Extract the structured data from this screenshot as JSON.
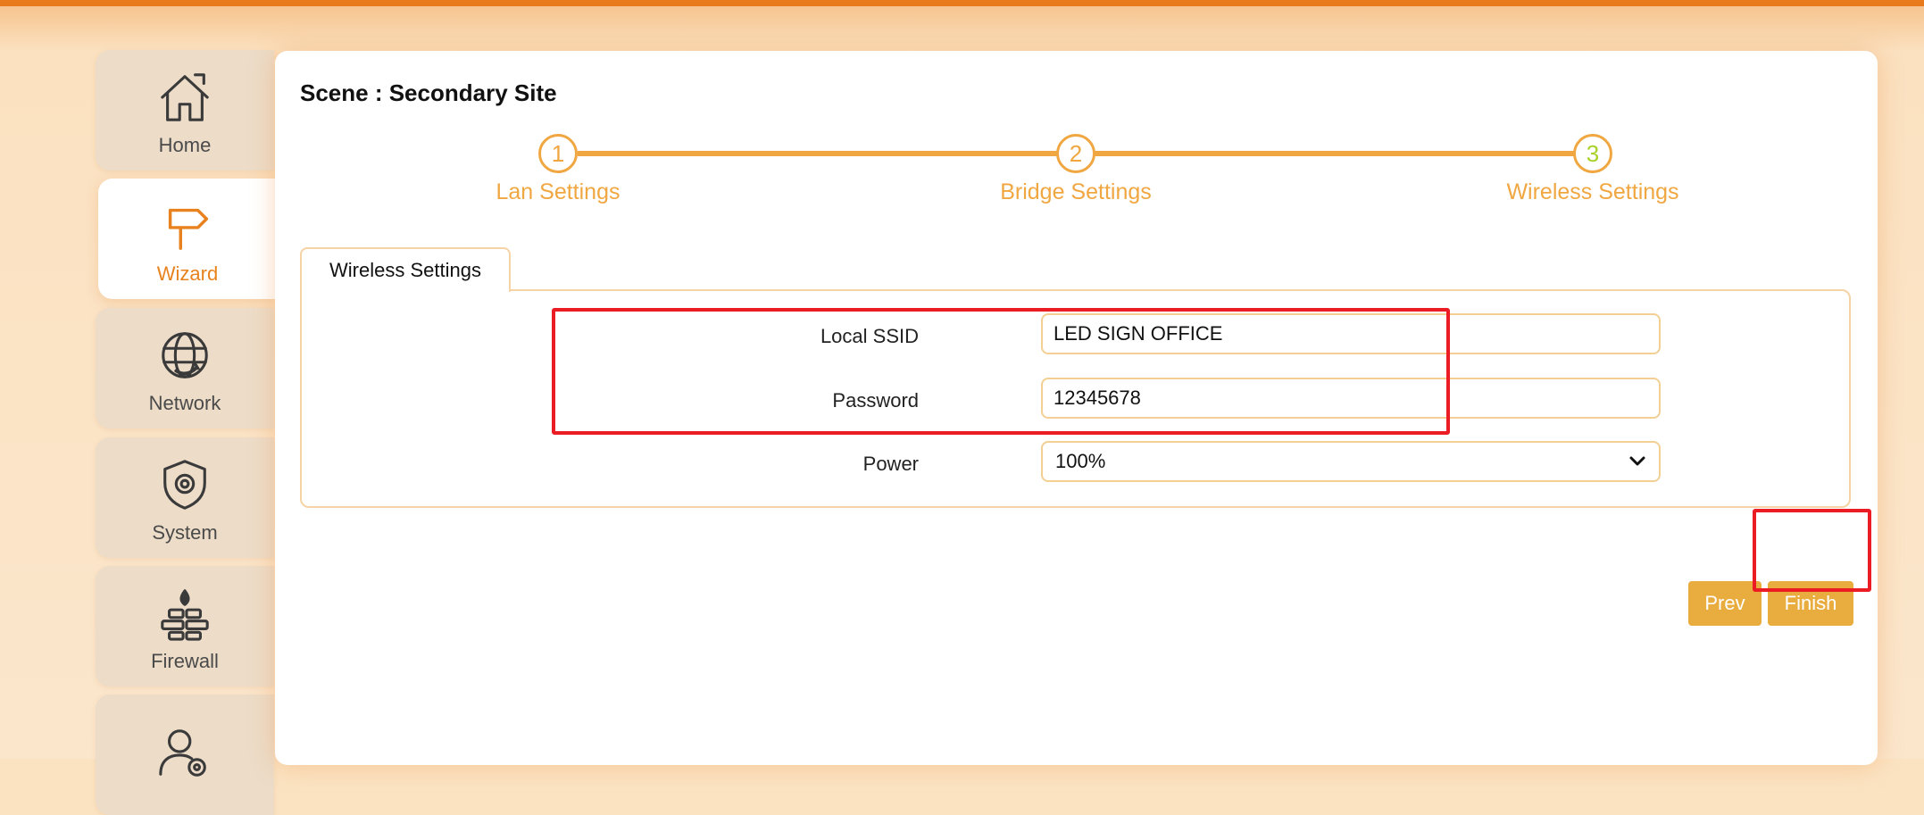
{
  "sidebar": {
    "items": [
      {
        "label": "Home",
        "icon": "home-icon"
      },
      {
        "label": "Wizard",
        "icon": "signpost-icon",
        "active": true
      },
      {
        "label": "Network",
        "icon": "globe-icon"
      },
      {
        "label": "System",
        "icon": "shield-gear-icon"
      },
      {
        "label": "Firewall",
        "icon": "firewall-icon"
      },
      {
        "label": "",
        "icon": "user-gear-icon"
      }
    ]
  },
  "scene": {
    "title": "Scene : Secondary Site"
  },
  "stepper": {
    "steps": [
      {
        "number": "1",
        "label": "Lan Settings"
      },
      {
        "number": "2",
        "label": "Bridge Settings"
      },
      {
        "number": "3",
        "label": "Wireless Settings"
      }
    ],
    "current_step": 3
  },
  "tab": {
    "label": "Wireless Settings"
  },
  "form": {
    "ssid_label": "Local SSID",
    "ssid_value": "LED SIGN OFFICE",
    "password_label": "Password",
    "password_value": "12345678",
    "power_label": "Power",
    "power_value": "100%"
  },
  "buttons": {
    "prev": "Prev",
    "finish": "Finish"
  },
  "colors": {
    "accent": "#f0a741",
    "nav_active": "#e8821e",
    "highlight": "#ec1c24",
    "current_step": "#a8d22a"
  }
}
